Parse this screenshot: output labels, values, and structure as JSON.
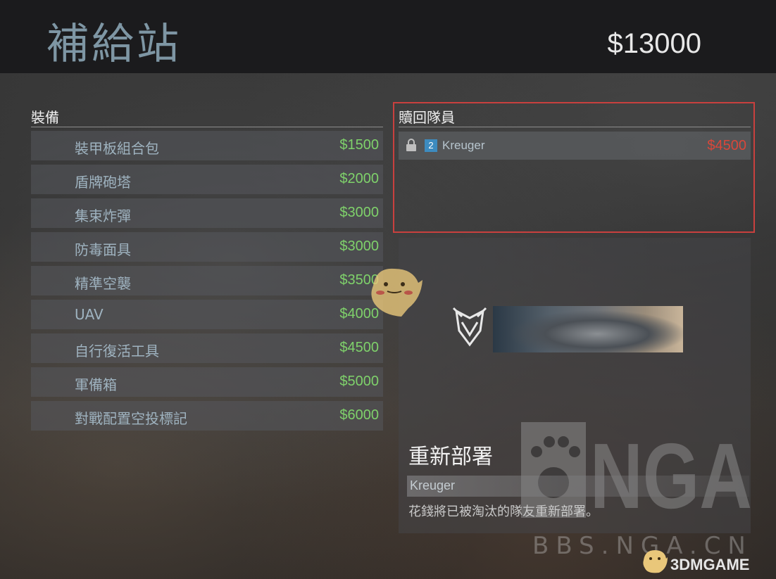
{
  "header": {
    "title": "補給站",
    "money": "$13000"
  },
  "equipment": {
    "title": "裝備",
    "items": [
      {
        "name": "裝甲板組合包",
        "price": "$1500"
      },
      {
        "name": "盾牌砲塔",
        "price": "$2000"
      },
      {
        "name": "集束炸彈",
        "price": "$3000"
      },
      {
        "name": "防毒面具",
        "price": "$3000"
      },
      {
        "name": "精準空襲",
        "price": "$3500"
      },
      {
        "name": "UAV",
        "price": "$4000"
      },
      {
        "name": "自行復活工具",
        "price": "$4500"
      },
      {
        "name": "軍備箱",
        "price": "$5000"
      },
      {
        "name": "對戰配置空投標記",
        "price": "$6000"
      }
    ],
    "price_color": "#7fd26b"
  },
  "revive": {
    "title": "贖回隊員",
    "players": [
      {
        "rank": "2",
        "name": "Kreuger",
        "price": "$4500",
        "locked": true
      }
    ],
    "highlight_color": "#c9403e"
  },
  "detail": {
    "title": "重新部署",
    "player": "Kreuger",
    "description": "花錢將已被淘汰的隊友重新部署。"
  },
  "watermarks": {
    "nga": "NGA",
    "bbs": "BBS.NGA.CN",
    "site": "3DMGAME"
  },
  "icons": {
    "lock": "lock-icon",
    "emblem": "emblem-icon"
  }
}
